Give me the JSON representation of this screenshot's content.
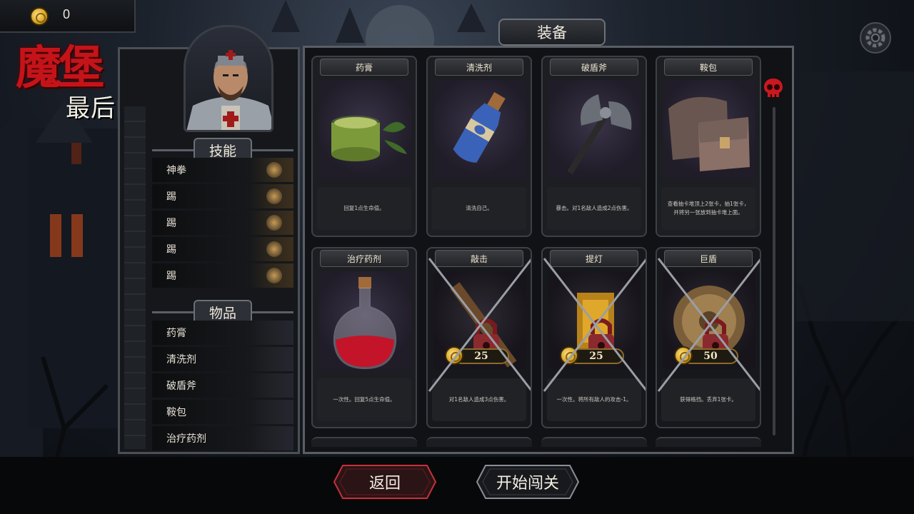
{
  "gold": {
    "icon": "gold-coin-icon",
    "amount": "0"
  },
  "logo": {
    "main": "魔堡",
    "sub": "最后的仪式"
  },
  "sidebar": {
    "skills_header": "技能",
    "skills": [
      {
        "label": "神拳"
      },
      {
        "label": "踢"
      },
      {
        "label": "踢"
      },
      {
        "label": "踢"
      },
      {
        "label": "踢"
      }
    ],
    "items_header": "物品",
    "items": [
      {
        "label": "药膏"
      },
      {
        "label": "清洗剂"
      },
      {
        "label": "破盾斧"
      },
      {
        "label": "鞍包"
      },
      {
        "label": "治疗药剂"
      }
    ]
  },
  "equipment": {
    "title": "装备",
    "cards": [
      {
        "name": "药膏",
        "desc": "回复1点生命值。",
        "locked": false
      },
      {
        "name": "清洗剂",
        "desc": "清洗自己。",
        "locked": false
      },
      {
        "name": "破盾斧",
        "desc": "暴击。对1名敌人造成2点伤害。",
        "locked": false
      },
      {
        "name": "鞍包",
        "desc": "查看抽卡堆顶上2张卡，抽1张卡，并将另一张放到抽卡堆上面。",
        "locked": false
      },
      {
        "name": "治疗药剂",
        "desc": "一次性。回复5点生命值。",
        "locked": false
      },
      {
        "name": "敲击",
        "desc": "对1名敌人造成3点伤害。",
        "locked": true,
        "price": "25"
      },
      {
        "name": "提灯",
        "desc": "一次性。将所有敌人的攻击-1。",
        "locked": true,
        "price": "25"
      },
      {
        "name": "巨盾",
        "desc": "获得格挡。丢弃1张卡。",
        "locked": true,
        "price": "50"
      }
    ]
  },
  "buttons": {
    "back": "返回",
    "start": "开始闯关"
  },
  "colors": {
    "accent_red": "#c4141a",
    "gold": "#d6a11f",
    "panel": "#101215"
  }
}
